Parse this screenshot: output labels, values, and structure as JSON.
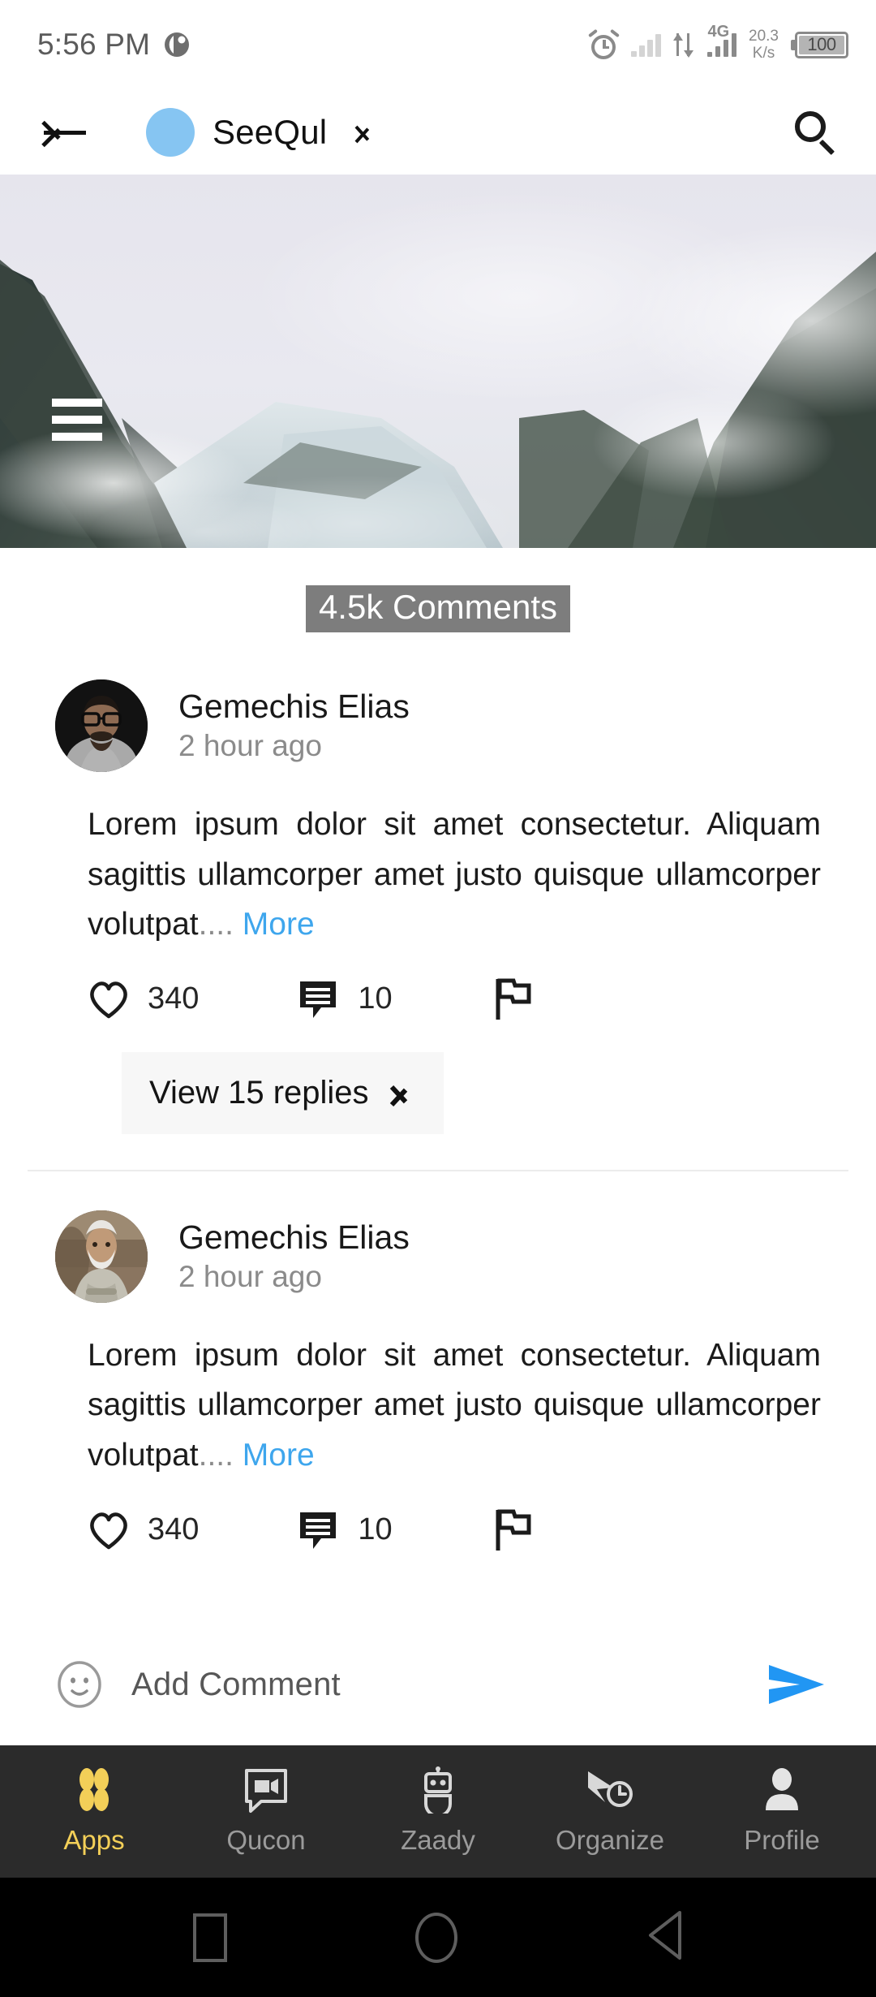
{
  "statusbar": {
    "time": "5:56 PM",
    "alarm_icon": "alarm-clock-icon",
    "signal_icon": "signal-bars-icon",
    "data_transfer_icon": "data-transfer-arrows-icon",
    "network_label": "4G",
    "network_icon": "cellular-signal-icon",
    "speed_value": "20.3",
    "speed_unit": "K/s",
    "battery_level": "100",
    "battery_icon": "battery-icon"
  },
  "appbar": {
    "back_icon": "back-arrow-icon",
    "avatar_icon": "channel-avatar",
    "title": "SeeQul",
    "chevron_icon": "chevron-right-icon",
    "search_icon": "search-icon"
  },
  "hero": {
    "menu_icon": "hamburger-menu-icon",
    "alt": "misty-mountain-landscape"
  },
  "comments": {
    "header": "4.5k Comments",
    "items": [
      {
        "author": "Gemechis Elias",
        "time": "2 hour ago",
        "avatar": "avatar-man-with-glasses",
        "text": "Lorem ipsum dolor sit amet consectetur. Aliquam sagittis ullamcorper amet justo quisque ullamcorper volutpat",
        "ellipsis": "....",
        "more_label": "More",
        "likes": "340",
        "like_icon": "heart-icon",
        "replies_count": "10",
        "reply_icon": "comment-bubble-icon",
        "report_icon": "flag-icon",
        "view_replies_label": "View 15 replies",
        "view_replies_chevron": "chevron-right-icon"
      },
      {
        "author": "Gemechis Elias",
        "time": "2 hour ago",
        "avatar": "avatar-elderly-man",
        "text": "Lorem ipsum dolor sit amet consectetur. Aliquam sagittis ullamcorper amet justo quisque ullamcorper volutpat",
        "ellipsis": "....",
        "more_label": "More",
        "likes": "340",
        "like_icon": "heart-icon",
        "replies_count": "10",
        "reply_icon": "comment-bubble-icon",
        "report_icon": "flag-icon"
      }
    ]
  },
  "add_comment": {
    "emoji_icon": "emoji-smiley-icon",
    "placeholder": "Add Comment",
    "send_icon": "send-arrow-icon",
    "send_color": "#2196f3"
  },
  "bottomnav": {
    "active_color": "#f3cf58",
    "inactive_color": "#9b9b9b",
    "items": [
      {
        "label": "Apps",
        "icon": "apps-flower-icon",
        "active": true
      },
      {
        "label": "Qucon",
        "icon": "video-chat-icon",
        "active": false
      },
      {
        "label": "Zaady",
        "icon": "robot-icon",
        "active": false
      },
      {
        "label": "Organize",
        "icon": "arrow-clock-icon",
        "active": false
      },
      {
        "label": "Profile",
        "icon": "person-icon",
        "active": false
      }
    ]
  },
  "androidnav": {
    "recents_icon": "square-recents-icon",
    "home_icon": "circle-home-icon",
    "back_icon": "triangle-back-icon"
  }
}
